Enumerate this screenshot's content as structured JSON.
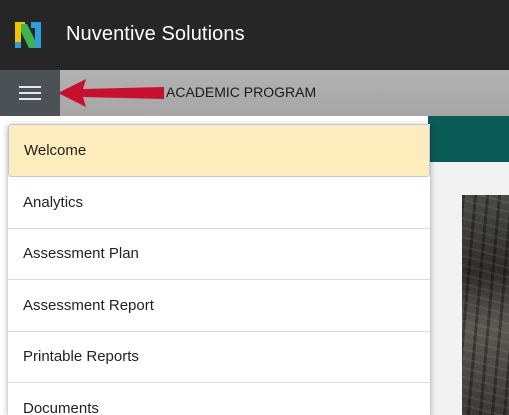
{
  "app": {
    "title": "Nuventive Solutions",
    "logo_icon": "nuventive-logo-icon",
    "colors": {
      "topbar": "#262626",
      "subbar": "#acacac",
      "hamburger_bg": "#4b5256",
      "accent_teal": "#0b5b57",
      "active_item": "#fdecbc",
      "arrow": "#c8102e"
    }
  },
  "subbar": {
    "menu_icon": "hamburger-menu-icon",
    "program_label": "ACADEMIC PROGRAM",
    "annotation_icon": "red-arrow-icon"
  },
  "menu": {
    "items": [
      {
        "label": "Welcome",
        "active": true
      },
      {
        "label": "Analytics",
        "active": false
      },
      {
        "label": "Assessment Plan",
        "active": false
      },
      {
        "label": "Assessment Report",
        "active": false
      },
      {
        "label": "Printable Reports",
        "active": false
      },
      {
        "label": "Documents",
        "active": false
      }
    ]
  }
}
